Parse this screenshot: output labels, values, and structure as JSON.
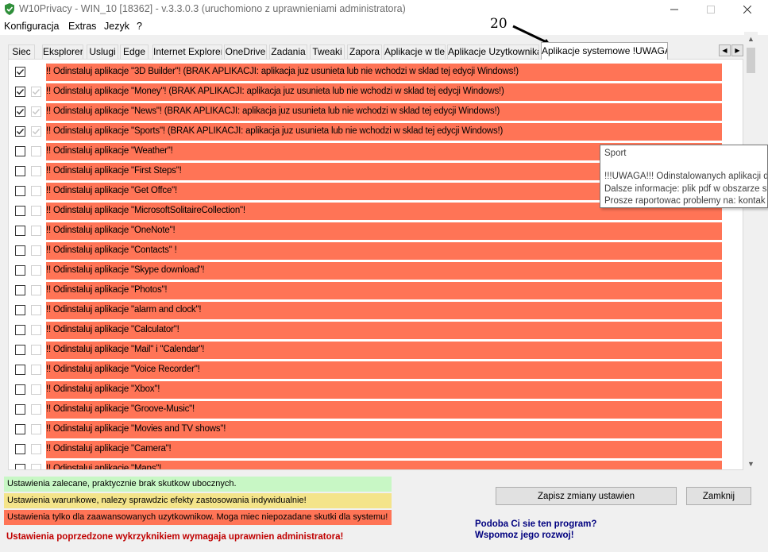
{
  "window": {
    "title": "W10Privacy - WIN_10 [18362]  - v.3.3.0.3 (uruchomiono z uprawnieniami administratora)",
    "icon": "shield-icon"
  },
  "menu": [
    "Konfiguracja",
    "Extras",
    "Jezyk",
    "?"
  ],
  "annotation": {
    "number": "20"
  },
  "tabs": [
    "Siec",
    "Eksplorer",
    "Uslugi",
    "Edge",
    "Internet Explorer",
    "OneDrive",
    "Zadania",
    "Tweaki",
    "Zapora",
    "Aplikacje w tle",
    "Aplikacje Uzytkownika",
    "Aplikacje systemowe !UWAGA!"
  ],
  "active_tab": "Aplikacje systemowe !UWAGA!",
  "rows": [
    {
      "label": "!! Odinstaluj aplikacje \"3D Builder\"! (BRAK APLIKACJI: aplikacja juz usunieta lub nie wchodzi w sklad tej edycji Windows!)",
      "checked": true,
      "second_box": false
    },
    {
      "label": "!! Odinstaluj aplikacje \"Money\"! (BRAK APLIKACJI: aplikacja juz usunieta lub nie wchodzi w sklad tej edycji Windows!)",
      "checked": true,
      "second_box": true
    },
    {
      "label": "!! Odinstaluj aplikacje \"News\"! (BRAK APLIKACJI: aplikacja juz usunieta lub nie wchodzi w sklad tej edycji Windows!)",
      "checked": true,
      "second_box": true
    },
    {
      "label": "!! Odinstaluj aplikacje \"Sports\"! (BRAK APLIKACJI: aplikacja juz usunieta lub nie wchodzi w sklad tej edycji Windows!)",
      "checked": true,
      "second_box": true
    },
    {
      "label": "!! Odinstaluj aplikacje \"Weather\"!",
      "checked": false,
      "second_box": true
    },
    {
      "label": "!! Odinstaluj aplikacje \"First Steps\"!",
      "checked": false,
      "second_box": true
    },
    {
      "label": "!! Odinstaluj aplikacje \"Get Offce\"!",
      "checked": false,
      "second_box": true
    },
    {
      "label": "!! Odinstaluj aplikacje \"MicrosoftSolitaireCollection\"!",
      "checked": false,
      "second_box": true
    },
    {
      "label": "!! Odinstaluj aplikacje \"OneNote\"!",
      "checked": false,
      "second_box": true
    },
    {
      "label": "!! Odinstaluj aplikacje \"Contacts\" !",
      "checked": false,
      "second_box": true
    },
    {
      "label": "!! Odinstaluj aplikacje \"Skype download\"!",
      "checked": false,
      "second_box": true
    },
    {
      "label": "!! Odinstaluj aplikacje \"Photos\"!",
      "checked": false,
      "second_box": true
    },
    {
      "label": "!! Odinstaluj aplikacje \"alarm and clock\"!",
      "checked": false,
      "second_box": true
    },
    {
      "label": "!! Odinstaluj aplikacje \"Calculator\"!",
      "checked": false,
      "second_box": true
    },
    {
      "label": "!! Odinstaluj aplikacje \"Mail\" i \"Calendar\"!",
      "checked": false,
      "second_box": true
    },
    {
      "label": "!! Odinstaluj aplikacje \"Voice Recorder\"!",
      "checked": false,
      "second_box": true
    },
    {
      "label": "!! Odinstaluj aplikacje \"Xbox\"!",
      "checked": false,
      "second_box": true
    },
    {
      "label": "!! Odinstaluj aplikacje \"Groove-Music\"!",
      "checked": false,
      "second_box": true
    },
    {
      "label": "!! Odinstaluj aplikacje \"Movies and TV shows\"!",
      "checked": false,
      "second_box": true
    },
    {
      "label": "!! Odinstaluj aplikacje \"Camera\"!",
      "checked": false,
      "second_box": true
    },
    {
      "label": "!! Odinstaluj aplikacje \"Maps\"!",
      "checked": false,
      "second_box": true
    }
  ],
  "tooltip": {
    "title": "Sport",
    "line1": "!!!UWAGA!!! Odinstalowanych aplikacji d",
    "line2": "Dalsze informacje: plik pdf w obszarze s",
    "line3": "Prosze raportowac problemy na: kontak"
  },
  "legend": {
    "green": "Ustawienia zalecane, praktycznie brak skutkow ubocznych.",
    "yellow": "Ustawienia warunkowe, nalezy sprawdzic efekty zastosowania indywidualnie!",
    "red": "Ustawienia tylko dla zaawansowanych uzytkownikow. Moga miec niepozadane skutki dla systemu!"
  },
  "warning": "Ustawienia poprzedzone wykrzyknikiem wymagaja uprawnien administratora!",
  "buttons": {
    "save": "Zapisz zmiany ustawien",
    "close": "Zamknij"
  },
  "promo": {
    "line1": "Podoba Ci sie ten program?",
    "line2": "Wspomoz jego rozwoj!"
  },
  "colors": {
    "red_row": "#ff7456",
    "green": "#c8f7c5",
    "yellow": "#f4e48a",
    "warning_text": "#c00000",
    "link_text": "#00007f"
  }
}
